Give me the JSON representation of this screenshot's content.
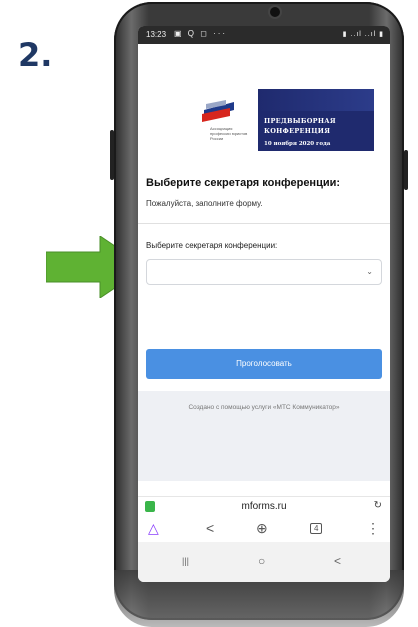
{
  "step": {
    "number": "2."
  },
  "colors": {
    "arrow": "#5fb233",
    "accent_button": "#4a90e2",
    "banner_bg": "#1f2a6e",
    "lock": "#3ab54a"
  },
  "statusbar": {
    "time": "13:23",
    "icons": "▣ Q ◻ ···",
    "right_icons": "▮ ..ıl ..ıl ▮"
  },
  "banner": {
    "line1": "ПРЕДВЫБОРНАЯ",
    "line2": "КОНФЕРЕНЦИЯ",
    "line3": "10 ноября 2020 года"
  },
  "logo": {
    "text": "Ассоциация профессии юристов России"
  },
  "form": {
    "title": "Выберите секретаря конференции:",
    "subtitle": "Пожалуйста, заполните форму.",
    "field_label": "Выберите секретаря конференции:",
    "select_value": "",
    "chevron": "⌄",
    "submit_label": "Проголосовать",
    "footer": "Создано с помощью услуги «МТС Коммуникатор»"
  },
  "urlbar": {
    "url": "mforms.ru",
    "reload": "↻"
  },
  "browser_nav": {
    "alice": "△",
    "share": "<",
    "add": "⊕",
    "tabs": "4",
    "menu": "⋮"
  },
  "android_nav": {
    "recents": "|||",
    "home": "○",
    "back": "<"
  }
}
